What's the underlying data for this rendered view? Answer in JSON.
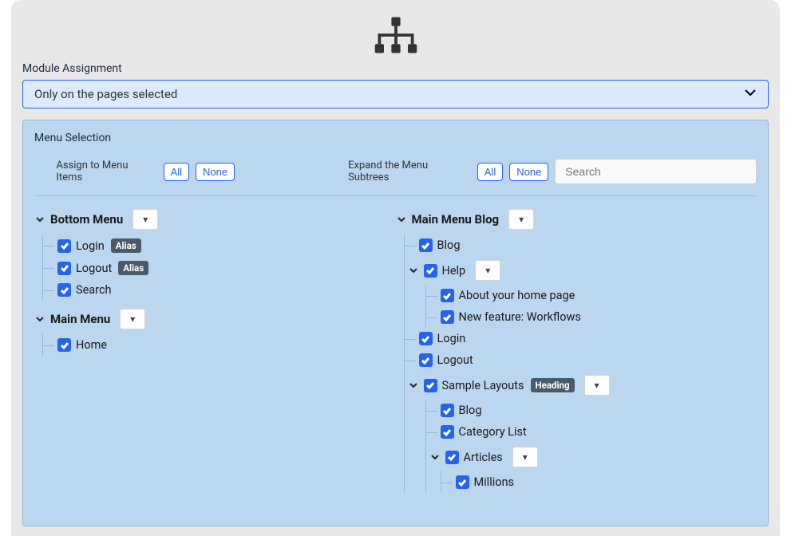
{
  "header": {
    "module_label": "Module Assignment",
    "module_selected": "Only on the pages selected"
  },
  "panel": {
    "title": "Menu Selection",
    "assign_label": "Assign to Menu Items",
    "expand_label": "Expand the Menu Subtrees",
    "btn_all": "All",
    "btn_none": "None",
    "search_placeholder": "Search"
  },
  "badges": {
    "alias": "Alias",
    "heading": "Heading"
  },
  "left": {
    "bottom_menu": "Bottom Menu",
    "bm_login": "Login",
    "bm_logout": "Logout",
    "bm_search": "Search",
    "main_menu": "Main Menu",
    "mm_home": "Home"
  },
  "right": {
    "mm_blog_title": "Main Menu Blog",
    "blog": "Blog",
    "help": "Help",
    "help_about": "About your home page",
    "help_workflows": "New feature: Workflows",
    "login": "Login",
    "logout": "Logout",
    "sample_layouts": "Sample Layouts",
    "sl_blog": "Blog",
    "sl_category": "Category List",
    "sl_articles": "Articles",
    "sl_millions": "Millions"
  }
}
